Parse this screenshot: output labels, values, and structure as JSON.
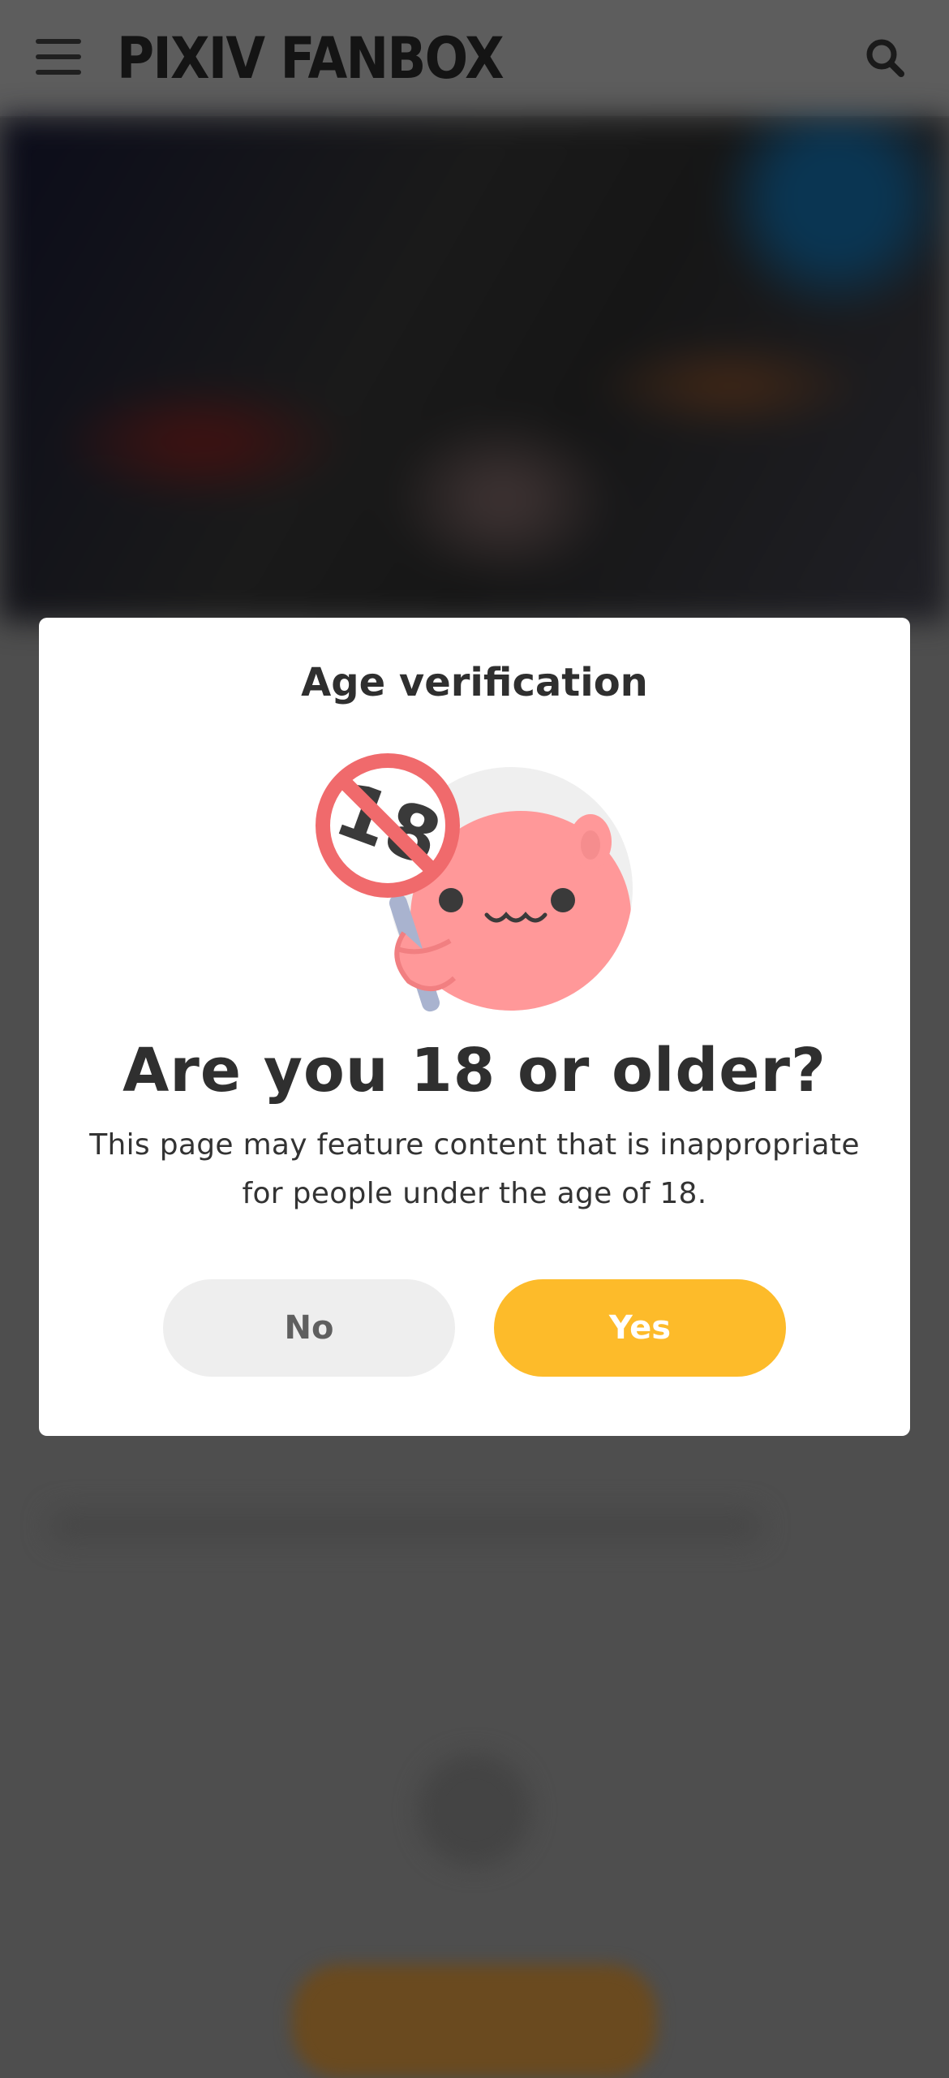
{
  "header": {
    "brand": "PIXIV FANBOX",
    "menu_icon": "hamburger-menu-icon",
    "search_icon": "search-icon"
  },
  "modal": {
    "title": "Age verification",
    "illustration": "pink-mascot-holding-18-prohibited-sign",
    "question": "Are you 18 or older?",
    "description": "This page may feature content that is inappropriate for people under the age of 18.",
    "no_label": "No",
    "yes_label": "Yes"
  },
  "colors": {
    "accent_yes": "#fdbb2a",
    "button_no": "#eeeeee",
    "overlay": "#4e4e4e",
    "text_dark": "#2f2f2f"
  }
}
